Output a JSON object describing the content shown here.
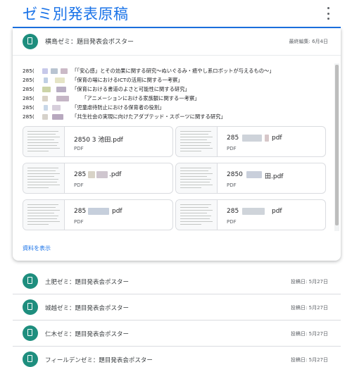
{
  "header": {
    "title": "ゼミ別発表原稿"
  },
  "expanded_post": {
    "title": "横島ゼミ：題目発表会ポスター",
    "date": "最終編集: 6月4日",
    "description_lines": [
      {
        "id": "285(",
        "text": "「「安心感」とその効果に関する研究～ぬいぐるみ・癒やし系ロボットが与えるもの～」"
      },
      {
        "id": "285(",
        "text": "「保育の場におけるICTの活用に関する一考察」"
      },
      {
        "id": "285(",
        "text": "「保育における書道のよさと可能性に関する研究」"
      },
      {
        "id": "285(",
        "text": "「アニメーションにおける家族観に関する一考察」"
      },
      {
        "id": "285(",
        "text": "「児童虐待防止における保育者の役割」"
      },
      {
        "id": "285(",
        "text": "「共生社会の実現に向けたアダプテッド・スポーツに関する研究」"
      }
    ],
    "attachments": [
      {
        "name_prefix": "285",
        "name_mid": "0",
        "name_suffix": "3 池田.pdf",
        "type": "PDF"
      },
      {
        "name_prefix": "285",
        "name_mid": "",
        "name_suffix": "pdf",
        "type": "PDF"
      },
      {
        "name_prefix": "285",
        "name_mid": "",
        "name_suffix": ".pdf",
        "type": "PDF"
      },
      {
        "name_prefix": "2850",
        "name_mid": "",
        "name_suffix": "田.pdf",
        "type": "PDF"
      },
      {
        "name_prefix": "285",
        "name_mid": "",
        "name_suffix": "pdf",
        "type": "PDF"
      },
      {
        "name_prefix": "285",
        "name_mid": "",
        "name_suffix": "pdf",
        "type": "PDF"
      }
    ],
    "show_more_label": "資料を表示"
  },
  "posts": [
    {
      "title": "土肥ゼミ：題目発表会ポスター",
      "date": "投稿日: 5月27日"
    },
    {
      "title": "城越ゼミ：題目発表会ポスター",
      "date": "投稿日: 5月27日"
    },
    {
      "title": "仁木ゼミ：題目発表会ポスター",
      "date": "投稿日: 5月27日"
    },
    {
      "title": "フィールデンゼミ：題目発表会ポスター",
      "date": "投稿日: 5月27日"
    }
  ],
  "colors": {
    "accent": "#1a73e8",
    "class_icon": "#1e8e7e"
  },
  "icons": {
    "menu": "more-vert-icon",
    "post": "assignment-icon"
  }
}
